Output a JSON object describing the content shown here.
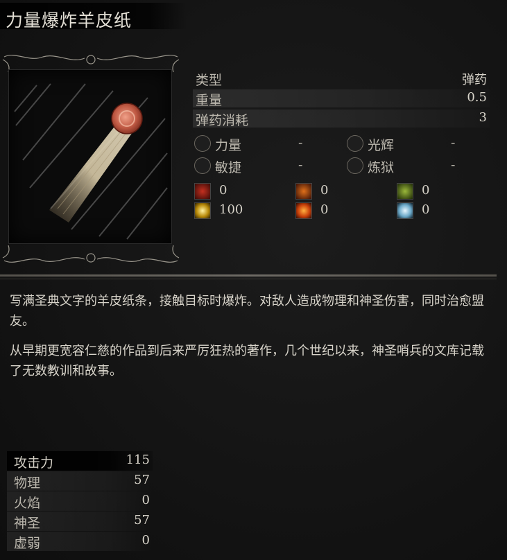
{
  "item": {
    "name": "力量爆炸羊皮纸"
  },
  "stats": [
    {
      "label": "类型",
      "value": "弹药"
    },
    {
      "label": "重量",
      "value": "0.5"
    },
    {
      "label": "弹药消耗",
      "value": "3"
    }
  ],
  "requirements": [
    {
      "label": "力量",
      "value": "-",
      "icon": "strength-icon"
    },
    {
      "label": "光辉",
      "value": "-",
      "icon": "radiance-icon"
    },
    {
      "label": "敏捷",
      "value": "-",
      "icon": "dexterity-icon"
    },
    {
      "label": "炼狱",
      "value": "-",
      "icon": "inferno-icon"
    }
  ],
  "affinities": [
    {
      "icon": "bleed-icon",
      "color": "#8a1a14",
      "value": "0"
    },
    {
      "icon": "fire-icon",
      "color": "#b8400e",
      "value": "0"
    },
    {
      "icon": "poison-icon",
      "color": "#6a8a1a",
      "value": "0"
    },
    {
      "icon": "holy-light-icon",
      "color": "#e8c41a",
      "value": "100"
    },
    {
      "icon": "explosion-icon",
      "color": "#e86a0e",
      "value": "0"
    },
    {
      "icon": "frost-icon",
      "color": "#8ac8e8",
      "value": "0"
    }
  ],
  "description": [
    "写满圣典文字的羊皮纸条，接触目标时爆炸。对敌人造成物理和神圣伤害，同时治愈盟友。",
    "从早期更宽容仁慈的作品到后来严厉狂热的著作，几个世纪以来，神圣哨兵的文库记载了无数教训和故事。"
  ],
  "attack": {
    "header": {
      "label": "攻击力",
      "value": "115"
    },
    "rows": [
      {
        "label": "物理",
        "value": "57"
      },
      {
        "label": "火焰",
        "value": "0"
      },
      {
        "label": "神圣",
        "value": "57"
      },
      {
        "label": "虚弱",
        "value": "0"
      }
    ]
  }
}
